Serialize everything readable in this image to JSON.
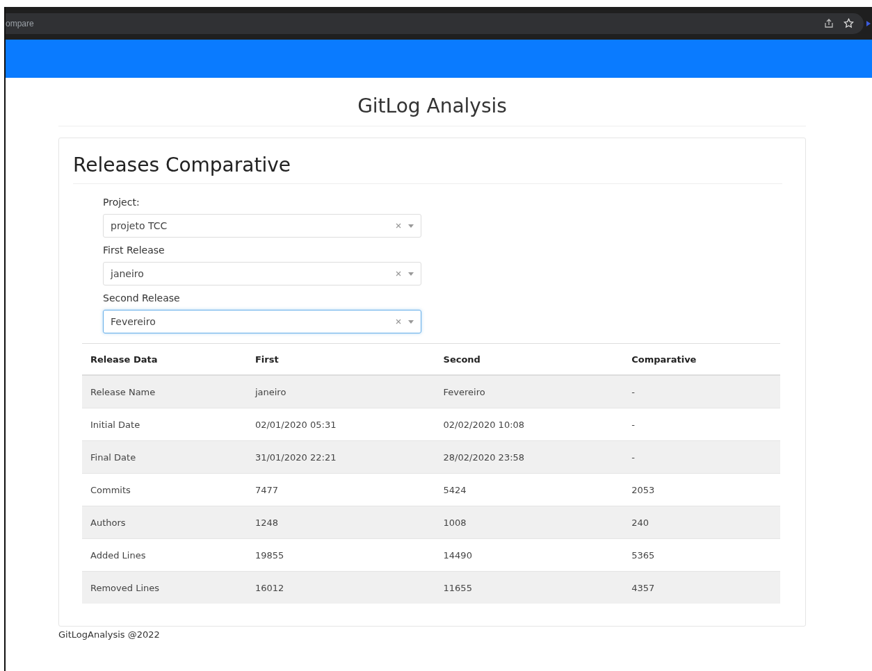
{
  "browser": {
    "address": "ompare"
  },
  "header": {
    "title": "GitLog Analysis"
  },
  "card": {
    "title": "Releases Comparative",
    "fields": [
      {
        "label": "Project:",
        "value": "projeto TCC",
        "focused": false
      },
      {
        "label": "First Release",
        "value": "janeiro",
        "focused": false
      },
      {
        "label": "Second Release",
        "value": "Fevereiro",
        "focused": true
      }
    ],
    "table": {
      "columns": [
        "Release Data",
        "First",
        "Second",
        "Comparative"
      ],
      "rows": [
        [
          "Release Name",
          "janeiro",
          "Fevereiro",
          "-"
        ],
        [
          "Initial Date",
          "02/01/2020 05:31",
          "02/02/2020 10:08",
          "-"
        ],
        [
          "Final Date",
          "31/01/2020 22:21",
          "28/02/2020 23:58",
          "-"
        ],
        [
          "Commits",
          "7477",
          "5424",
          "2053"
        ],
        [
          "Authors",
          "1248",
          "1008",
          "240"
        ],
        [
          "Added Lines",
          "19855",
          "14490",
          "5365"
        ],
        [
          "Removed Lines",
          "16012",
          "11655",
          "4357"
        ]
      ]
    }
  },
  "footer": {
    "text": "GitLogAnalysis @2022"
  }
}
